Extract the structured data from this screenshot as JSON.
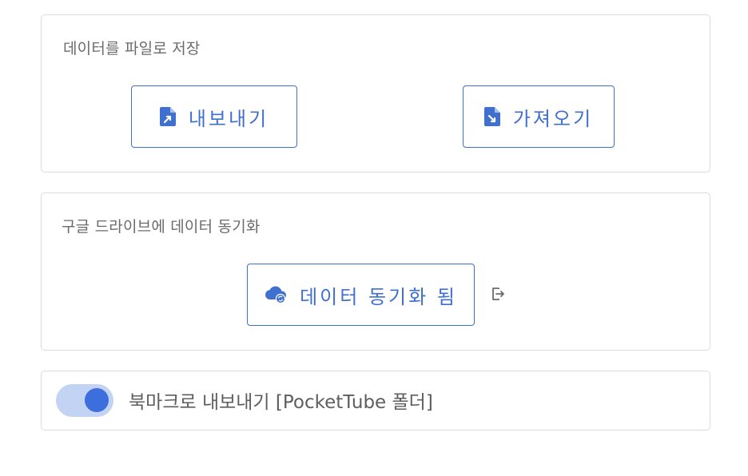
{
  "file_section": {
    "title": "데이터를 파일로 저장",
    "export_label": "내보내기",
    "export_icon": "file-export-icon",
    "import_label": "가져오기",
    "import_icon": "file-import-icon"
  },
  "drive_section": {
    "title": "구글 드라이브에 데이터 동기화",
    "sync_label": "데이터 동기화 됨",
    "sync_icon": "cloud-sync-icon",
    "logout_icon": "logout-icon"
  },
  "bookmark_section": {
    "toggle_on": true,
    "label": "북마크로 내보내기 [PocketTube 폴더]"
  },
  "colors": {
    "accent": "#3f6fcf",
    "toggle_track": "#c3d3f3",
    "toggle_knob": "#3c6ede",
    "border": "#dadce0",
    "title_text": "#6b6b6b"
  }
}
